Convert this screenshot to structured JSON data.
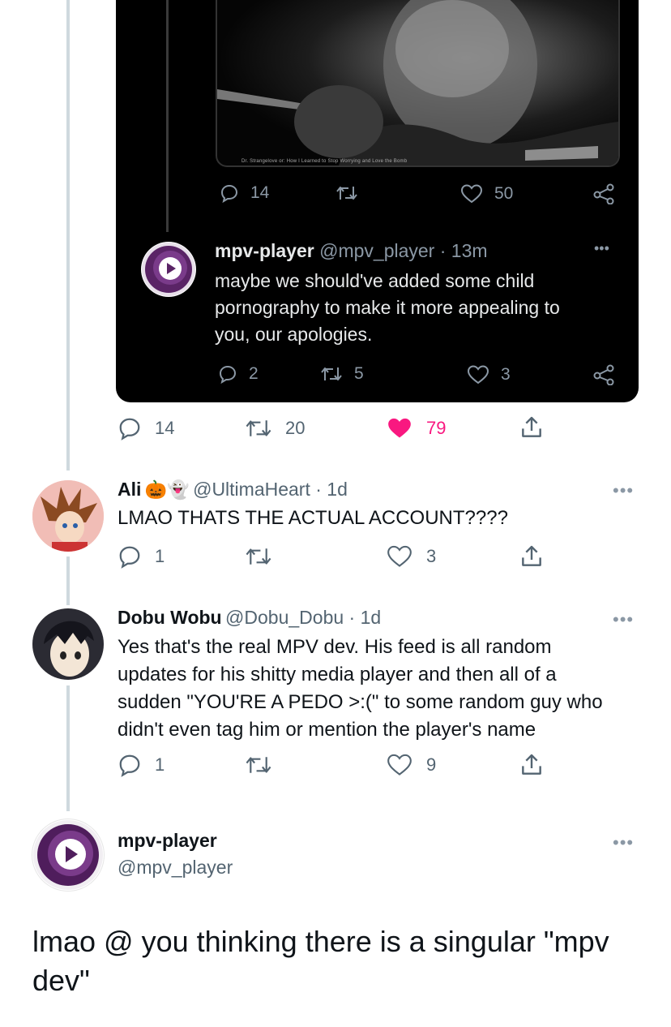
{
  "quoted_thread": {
    "photo_caption": "Dr. Strangelove or: How I Learned to Stop Worrying and Love the Bomb",
    "top_actions": {
      "replies": "14",
      "likes": "50"
    },
    "reply": {
      "name": "mpv-player",
      "handle_time": "@mpv_player · 13m",
      "text_line1": "maybe we should've added some child",
      "text_line2": "pornography to make it more appealing to",
      "text_line3": "you, our apologies.",
      "replies": "2",
      "retweets": "5",
      "likes": "3"
    }
  },
  "main_tweet_actions": {
    "replies": "14",
    "retweets": "20",
    "likes": "79",
    "like_color": "#f91880"
  },
  "replies": [
    {
      "name": "Ali",
      "emojis": "🎃👻",
      "handle_time": "@UltimaHeart · 1d",
      "text": "LMAO THATS THE ACTUAL ACCOUNT????",
      "replies": "1",
      "likes": "3"
    },
    {
      "name": "Dobu Wobu",
      "handle_time": "@Dobu_Dobu · 1d",
      "text_line1": "Yes that's the real MPV dev. His feed is all random",
      "text_line2": "updates for his shitty media player and then all of a",
      "text_line3": "sudden \"YOU'RE A PEDO >:(\" to some random guy who",
      "text_line4": "didn't even tag him or mention the player's name",
      "replies": "1",
      "likes": "9"
    }
  ],
  "focused_tweet": {
    "name": "mpv-player",
    "handle": "@mpv_player",
    "text_line1": "lmao @ you thinking there is a singular \"mpv",
    "text_line2": "dev\""
  },
  "more_glyph": "•••",
  "colors": {
    "accent_purple": "#6b2d7b",
    "muted": "#536471",
    "thread_line": "#cfd9de"
  }
}
